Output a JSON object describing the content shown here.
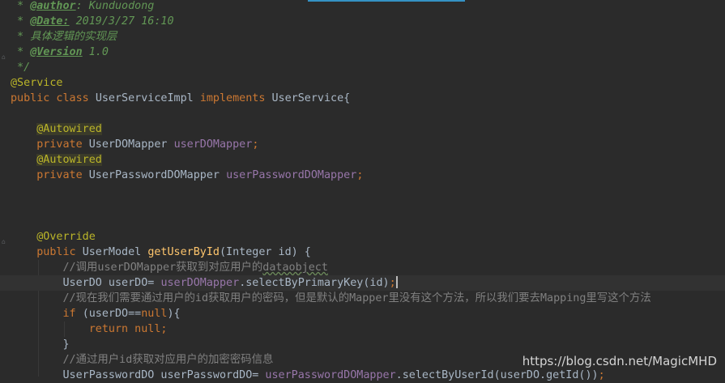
{
  "editor": {
    "lines": [
      {
        "tokens": [
          {
            "t": " * ",
            "c": "c-com"
          },
          {
            "t": "@author",
            "c": "c-tag"
          },
          {
            "t": ": ",
            "c": "c-com"
          },
          {
            "t": "Kunduodong",
            "c": "c-com"
          }
        ]
      },
      {
        "tokens": [
          {
            "t": " * ",
            "c": "c-com"
          },
          {
            "t": "@Date:",
            "c": "c-tag"
          },
          {
            "t": " 2019/3/27 16:10",
            "c": "c-com"
          }
        ]
      },
      {
        "tokens": [
          {
            "t": " * 具体逻辑的实现层",
            "c": "c-com"
          }
        ]
      },
      {
        "tokens": [
          {
            "t": " * ",
            "c": "c-com"
          },
          {
            "t": "@Version",
            "c": "c-tag"
          },
          {
            "t": " 1.0",
            "c": "c-com"
          }
        ]
      },
      {
        "tokens": [
          {
            "t": " */",
            "c": "c-com"
          }
        ]
      },
      {
        "tokens": [
          {
            "t": "@Service",
            "c": "c-ann"
          }
        ]
      },
      {
        "tokens": [
          {
            "t": "public class ",
            "c": "c-kw"
          },
          {
            "t": "UserServiceImpl ",
            "c": "c-plain"
          },
          {
            "t": "implements ",
            "c": "c-kw"
          },
          {
            "t": "UserService{",
            "c": "c-plain"
          }
        ]
      },
      {
        "tokens": []
      },
      {
        "tokens": [
          {
            "t": "    ",
            "c": "c-plain"
          },
          {
            "t": "@Autowired",
            "c": "c-ann-hl"
          }
        ]
      },
      {
        "tokens": [
          {
            "t": "    private ",
            "c": "c-kw"
          },
          {
            "t": "UserDOMapper ",
            "c": "c-plain"
          },
          {
            "t": "userDOMapper",
            "c": "c-field"
          },
          {
            "t": ";",
            "c": "c-kw"
          }
        ]
      },
      {
        "tokens": [
          {
            "t": "    ",
            "c": "c-plain"
          },
          {
            "t": "@Autowired",
            "c": "c-ann-hl"
          }
        ]
      },
      {
        "tokens": [
          {
            "t": "    private ",
            "c": "c-kw"
          },
          {
            "t": "UserPasswordDOMapper ",
            "c": "c-plain"
          },
          {
            "t": "userPasswordDOMapper",
            "c": "c-field"
          },
          {
            "t": ";",
            "c": "c-kw"
          }
        ]
      },
      {
        "tokens": []
      },
      {
        "tokens": []
      },
      {
        "tokens": []
      },
      {
        "tokens": [
          {
            "t": "    ",
            "c": "c-plain"
          },
          {
            "t": "@Override",
            "c": "c-ann"
          }
        ]
      },
      {
        "tokens": [
          {
            "t": "    public ",
            "c": "c-kw"
          },
          {
            "t": "UserModel ",
            "c": "c-plain"
          },
          {
            "t": "getUserById",
            "c": "c-method"
          },
          {
            "t": "(Integer id) {",
            "c": "c-plain"
          }
        ]
      },
      {
        "tokens": [
          {
            "t": "        //调用userDOMapper获取到对应用户的",
            "c": "c-line-com"
          },
          {
            "t": "dataobject",
            "c": "c-typo"
          }
        ]
      },
      {
        "current": true,
        "tokens": [
          {
            "t": "        UserDO userDO= ",
            "c": "c-plain"
          },
          {
            "t": "userDOMapper",
            "c": "c-field"
          },
          {
            "t": ".selectByPrimaryKey(id)",
            "c": "c-plain"
          },
          {
            "t": ";",
            "c": "c-kw"
          },
          {
            "caret": true
          }
        ]
      },
      {
        "tokens": [
          {
            "t": "        //现在我们需要通过用户的id获取用户的密码，但是默认的Mapper里没有这个方法，所以我们要去Mapping里写这个方法",
            "c": "c-line-com"
          }
        ]
      },
      {
        "tokens": [
          {
            "t": "        if ",
            "c": "c-kw"
          },
          {
            "t": "(userDO==",
            "c": "c-plain"
          },
          {
            "t": "null",
            "c": "c-kw"
          },
          {
            "t": "){",
            "c": "c-plain"
          }
        ]
      },
      {
        "tokens": [
          {
            "t": "            return null;",
            "c": "c-kw"
          }
        ]
      },
      {
        "tokens": [
          {
            "t": "        }",
            "c": "c-plain"
          }
        ]
      },
      {
        "tokens": [
          {
            "t": "        //通过用户id获取对应用户的加密密码信息",
            "c": "c-line-com"
          }
        ]
      },
      {
        "tokens": [
          {
            "t": "        UserPasswordDO userPasswordDO= ",
            "c": "c-plain"
          },
          {
            "t": "userPasswordDOMapper",
            "c": "c-field"
          },
          {
            "t": ".selectByUserId(userDO.getId())",
            "c": "c-plain"
          },
          {
            "t": ";",
            "c": "c-kw"
          }
        ]
      }
    ]
  },
  "watermark": {
    "text": "https://blog.csdn.net/MagicMHD"
  },
  "colors": {
    "background": "#2b2b2b",
    "keyword": "#cc7832",
    "annotation": "#bbb529",
    "field": "#9876aa",
    "method": "#ffc66d",
    "doc_comment": "#629755",
    "line_comment": "#808080",
    "plain": "#a9b7c6"
  }
}
